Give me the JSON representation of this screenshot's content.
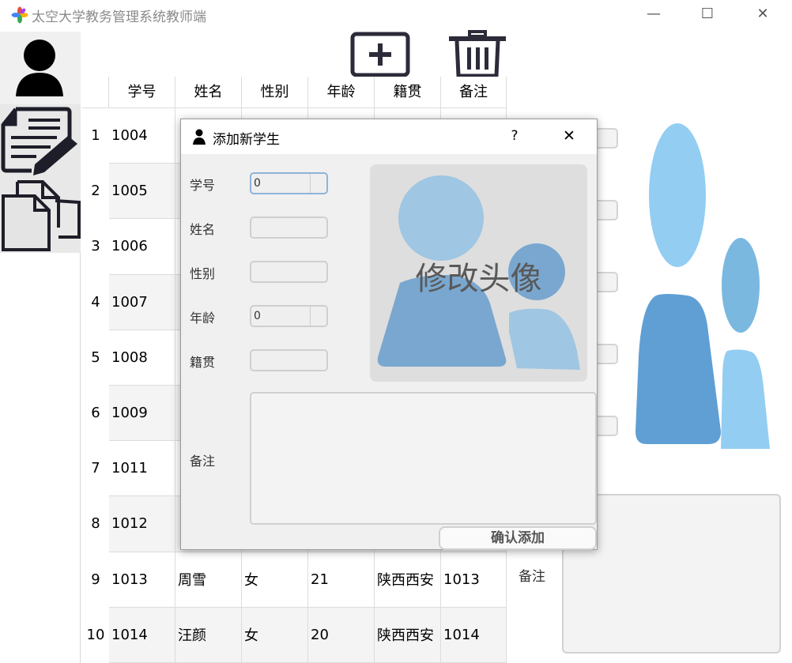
{
  "window": {
    "title": "太空大学教务管理系统教师端",
    "minimize": "—",
    "maximize": "☐",
    "close": "✕"
  },
  "sidebar": {
    "items": [
      {
        "name": "user-icon"
      },
      {
        "name": "edit-document-icon"
      },
      {
        "name": "copy-files-icon"
      }
    ]
  },
  "toolbar": {
    "add_icon": "plus-box-icon",
    "delete_icon": "trash-icon"
  },
  "table": {
    "headers": [
      "学号",
      "姓名",
      "性别",
      "年龄",
      "籍贯",
      "备注"
    ],
    "rows": [
      {
        "num": "1",
        "id": "1004",
        "name": "",
        "gender": "",
        "age": "",
        "origin": "",
        "note": ""
      },
      {
        "num": "2",
        "id": "1005",
        "name": "",
        "gender": "",
        "age": "",
        "origin": "",
        "note": ""
      },
      {
        "num": "3",
        "id": "1006",
        "name": "",
        "gender": "",
        "age": "",
        "origin": "",
        "note": ""
      },
      {
        "num": "4",
        "id": "1007",
        "name": "",
        "gender": "",
        "age": "",
        "origin": "",
        "note": ""
      },
      {
        "num": "5",
        "id": "1008",
        "name": "",
        "gender": "",
        "age": "",
        "origin": "",
        "note": ""
      },
      {
        "num": "6",
        "id": "1009",
        "name": "",
        "gender": "",
        "age": "",
        "origin": "",
        "note": ""
      },
      {
        "num": "7",
        "id": "1011",
        "name": "",
        "gender": "",
        "age": "",
        "origin": "",
        "note": ""
      },
      {
        "num": "8",
        "id": "1012",
        "name": "",
        "gender": "",
        "age": "",
        "origin": "",
        "note": ""
      },
      {
        "num": "9",
        "id": "1013",
        "name": "周雪",
        "gender": "女",
        "age": "21",
        "origin": "陕西西安",
        "note": "1013"
      },
      {
        "num": "10",
        "id": "1014",
        "name": "汪颜",
        "gender": "女",
        "age": "20",
        "origin": "陕西西安",
        "note": "1014"
      }
    ]
  },
  "right_panel": {
    "remark_label": "备注"
  },
  "dialog": {
    "title": "添加新学生",
    "help": "?",
    "close": "✕",
    "labels": {
      "id": "学号",
      "name": "姓名",
      "gender": "性别",
      "age": "年龄",
      "origin": "籍贯",
      "remark": "备注"
    },
    "values": {
      "id": "0",
      "name": "",
      "gender": "",
      "age": "0",
      "origin": "",
      "remark": ""
    },
    "avatar_text": "修改头像",
    "confirm_button": "确认添加"
  },
  "colors": {
    "avatar_light": "#9fc6e2",
    "avatar_mid": "#7aa7cf",
    "avatar_big_light": "#93cdf2",
    "avatar_big_dark": "#5f9fd4",
    "row_stripe": "#f4f4f4"
  }
}
